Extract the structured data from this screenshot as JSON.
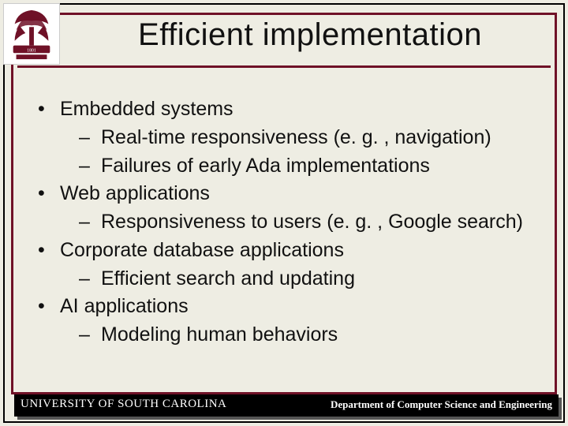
{
  "title": "Efficient implementation",
  "bullets": [
    {
      "level": 1,
      "text": "Embedded systems"
    },
    {
      "level": 2,
      "text": "Real-time responsiveness (e. g. , navigation)"
    },
    {
      "level": 2,
      "text": "Failures of early Ada implementations"
    },
    {
      "level": 1,
      "text": "Web applications"
    },
    {
      "level": 2,
      "text": "Responsiveness to users (e. g. , Google search)"
    },
    {
      "level": 1,
      "text": "Corporate database applications"
    },
    {
      "level": 2,
      "text": "Efficient search and updating"
    },
    {
      "level": 1,
      "text": "AI applications"
    },
    {
      "level": 2,
      "text": "Modeling human behaviors"
    }
  ],
  "footer": {
    "left": "UNIVERSITY OF SOUTH CAROLINA",
    "right": "Department of Computer Science and Engineering"
  }
}
